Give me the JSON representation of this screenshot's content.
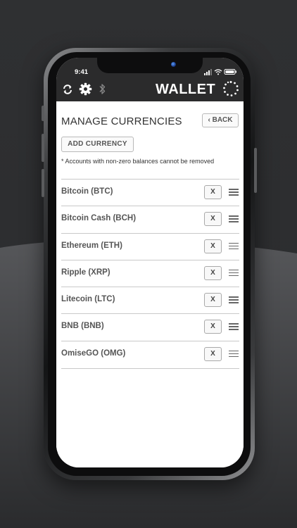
{
  "status_bar": {
    "time": "9:41"
  },
  "header": {
    "title": "WALLET",
    "icons": [
      "refresh-icon",
      "gear-icon",
      "bluetooth-icon",
      "wallet-logo-icon"
    ]
  },
  "page": {
    "title": "MANAGE CURRENCIES",
    "back_label": "‹ BACK",
    "add_label": "ADD CURRENCY",
    "note": "* Accounts with non-zero balances cannot be removed"
  },
  "currencies": [
    {
      "label": "Bitcoin (BTC)",
      "remove": "X"
    },
    {
      "label": "Bitcoin Cash (BCH)",
      "remove": "X"
    },
    {
      "label": "Ethereum (ETH)",
      "remove": "X"
    },
    {
      "label": "Ripple (XRP)",
      "remove": "X"
    },
    {
      "label": "Litecoin (LTC)",
      "remove": "X"
    },
    {
      "label": "BNB (BNB)",
      "remove": "X"
    },
    {
      "label": "OmiseGO (OMG)",
      "remove": "X"
    }
  ],
  "colors": {
    "header_bg": "#2b2b2c",
    "page_bg": "#2b2c2e",
    "wave": "#4a4b4d"
  }
}
